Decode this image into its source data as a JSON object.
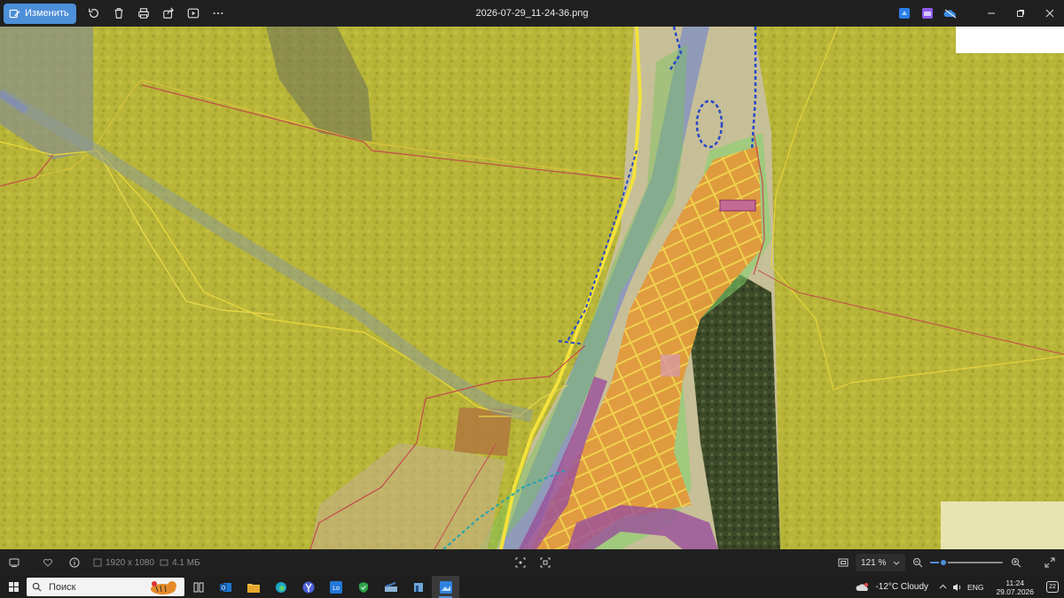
{
  "topbar": {
    "edit_label": "Изменить",
    "title": "2026-07-29_11-24-36.png",
    "tools": [
      "rotate-icon",
      "delete-icon",
      "print-icon",
      "share-icon",
      "slideshow-icon",
      "more-icon"
    ],
    "apps": [
      "clipchamp-icon",
      "video-editor-icon",
      "onedrive-icon"
    ]
  },
  "bottombar": {
    "dimensions": "1920 x 1080",
    "filesize": "4.1 МБ",
    "zoom_label": "121 %",
    "zoom_level_percent": 18
  },
  "taskbar": {
    "search_placeholder": "Поиск",
    "apps": [
      "task-view-icon",
      "outlook-icon",
      "file-explorer-icon",
      "edge-icon",
      "yandex-browser-icon",
      "lo-app-icon",
      "security-icon",
      "scanner-icon",
      "app-icon",
      "photos-icon"
    ],
    "weather": "-12°C  Cloudy",
    "lang": "ENG",
    "time": "11:24",
    "date": "29.07.2026",
    "notifications": "22"
  },
  "colors": {
    "accent": "#4d8fd8",
    "overlay_yellow": "#c9c635",
    "parcel_orange": "#e39a3a",
    "river_blue": "#7d8ec4",
    "zone_purple": "#9a4f9c",
    "zone_green": "#7fd36a"
  }
}
